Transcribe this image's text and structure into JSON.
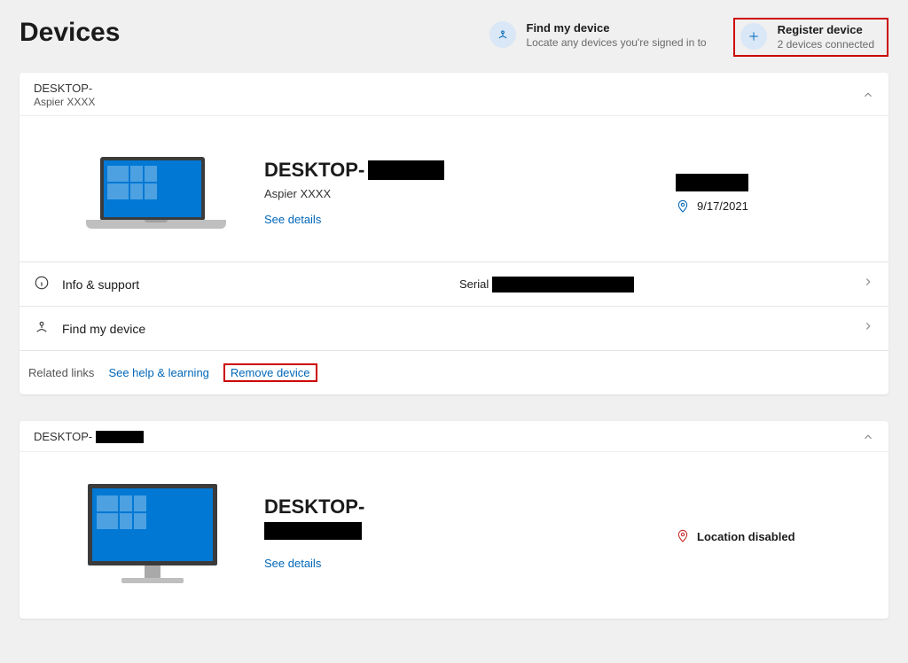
{
  "page": {
    "title": "Devices"
  },
  "header": {
    "find": {
      "label": "Find my device",
      "sub": "Locate any devices you're signed in to"
    },
    "register": {
      "label": "Register device",
      "sub": "2 devices connected"
    }
  },
  "device1": {
    "head_line1": "DESKTOP-",
    "head_line2": "Aspier XXXX",
    "title": "DESKTOP-",
    "subtitle": "Aspier XXXX",
    "details": "See details",
    "date": "9/17/2021",
    "row_info": "Info & support",
    "row_serial": "Serial",
    "row_find": "Find my device",
    "related": "Related links",
    "help": "See help & learning",
    "remove": "Remove device"
  },
  "device2": {
    "head_line1": "DESKTOP-",
    "title": "DESKTOP-",
    "details": "See details",
    "location_disabled": "Location disabled"
  }
}
